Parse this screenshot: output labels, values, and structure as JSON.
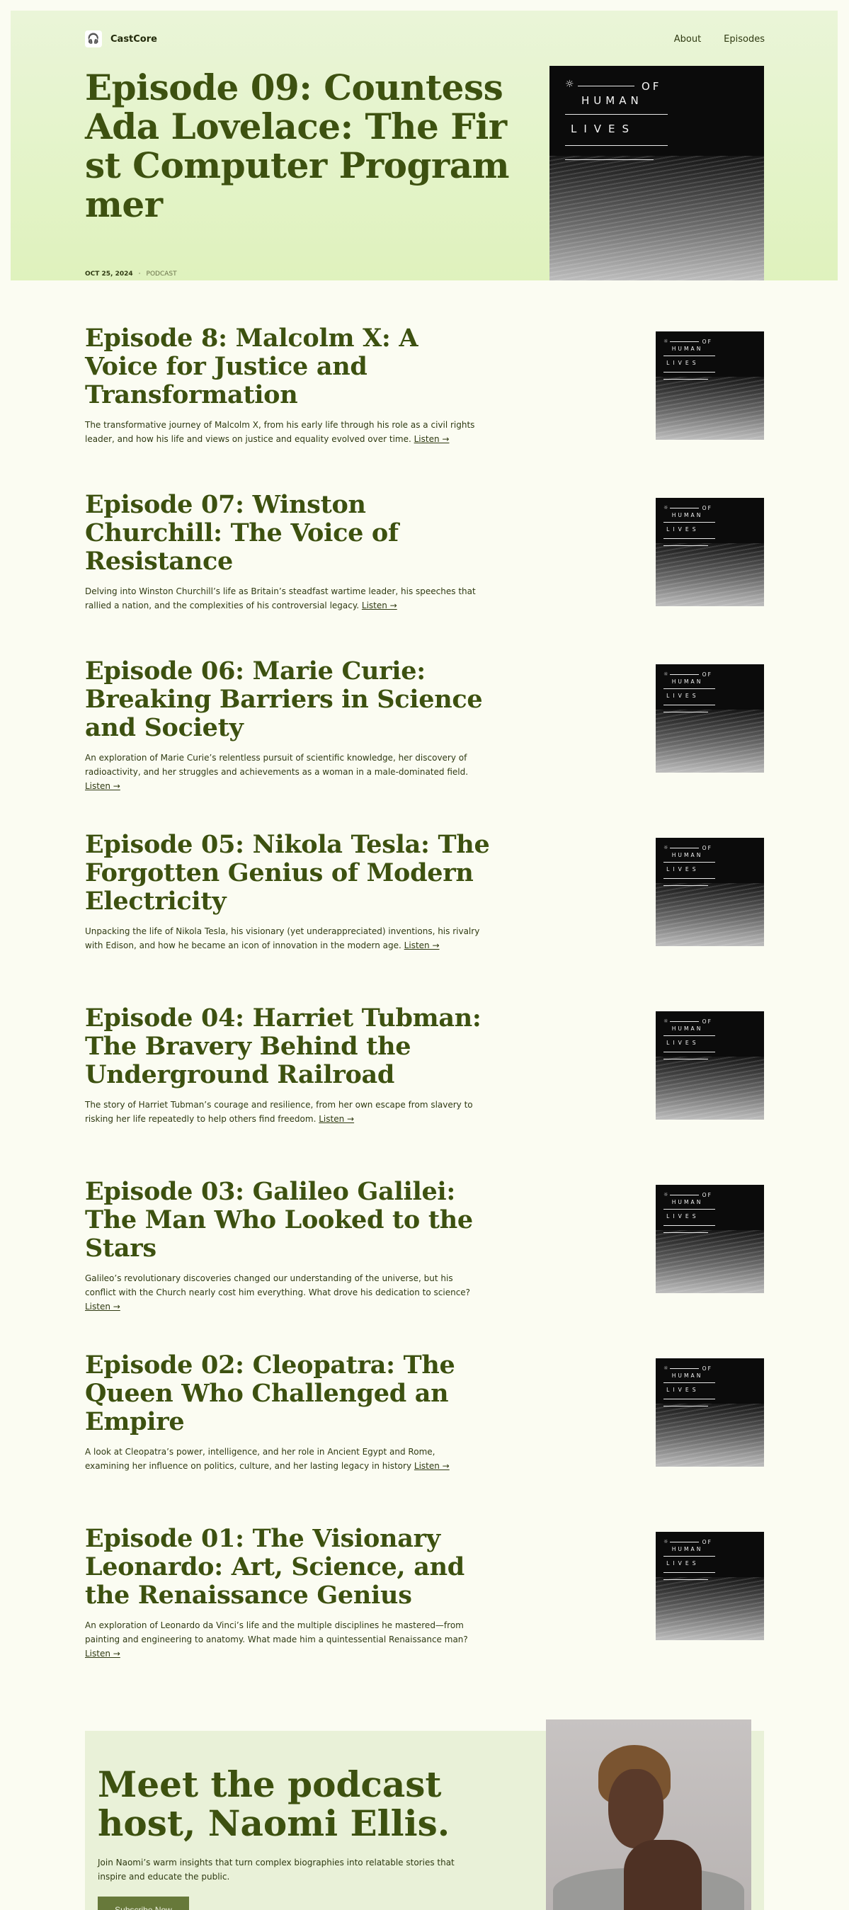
{
  "nav": {
    "brand": "CastCore",
    "links": [
      "About",
      "Episodes"
    ]
  },
  "hero": {
    "title": "Episode 09: Countess Ada Lovelace: The First Computer Programmer",
    "date": "OCT 25, 2024",
    "separator": "·",
    "category": "PODCAST"
  },
  "cover": {
    "of": "OF",
    "human": "HUMAN",
    "lives": "LIVES"
  },
  "episodes": [
    {
      "title": "Episode 8: Malcolm X: A Voice for Justice and Transformation",
      "desc": "The transformative journey of Malcolm X, from his early life through his role as a civil rights leader, and how his life and views on justice and equality evolved over time.",
      "listen": "Listen →"
    },
    {
      "title": "Episode 07: Winston Churchill: The Voice of Resistance",
      "desc": "Delving into Winston Churchill’s life as Britain’s steadfast wartime leader, his speeches that rallied a nation, and the complexities of his controversial legacy.",
      "listen": "Listen →"
    },
    {
      "title": "Episode 06: Marie Curie: Breaking Barriers in Science and Society",
      "desc": "An exploration of Marie Curie’s relentless pursuit of scientific knowledge, her discovery of radioactivity, and her struggles and achievements as a woman in a male-dominated field.",
      "listen": "Listen →"
    },
    {
      "title": "Episode 05: Nikola Tesla: The Forgotten Genius of Modern Electricity",
      "desc": "Unpacking the life of Nikola Tesla, his visionary (yet underappreciated) inventions, his rivalry with Edison, and how he became an icon of innovation in the modern age.",
      "listen": "Listen →"
    },
    {
      "title": "Episode 04: Harriet Tubman: The Bravery Behind the Underground Railroad",
      "desc": "The story of Harriet Tubman’s courage and resilience, from her own escape from slavery to risking her life repeatedly to help others find freedom.",
      "listen": "Listen →"
    },
    {
      "title": "Episode 03: Galileo Galilei: The Man Who Looked to the Stars",
      "desc": "Galileo’s revolutionary discoveries changed our understanding of the universe, but his conflict with the Church nearly cost him everything. What drove his dedication to science?",
      "listen": "Listen →"
    },
    {
      "title": "Episode 02: Cleopatra: The Queen Who Challenged an Empire",
      "desc": "A look at Cleopatra’s power, intelligence, and her role in Ancient Egypt and Rome, examining her influence on politics, culture, and her lasting legacy in history",
      "listen": "Listen →"
    },
    {
      "title": "Episode 01: The Visionary Leonardo: Art, Science, and the Renaissance Genius",
      "desc": "An exploration of Leonardo da Vinci’s life and the multiple disciplines he mastered—from painting and engineering to anatomy. What made him a quintessential Renaissance man?",
      "listen": "Listen →"
    }
  ],
  "host": {
    "title": "Meet the podcast host, Naomi Ellis.",
    "desc": "Join Naomi’s warm insights that turn complex biographies into relatable stories that inspire and educate the public.",
    "button": "Subscribe Now"
  }
}
